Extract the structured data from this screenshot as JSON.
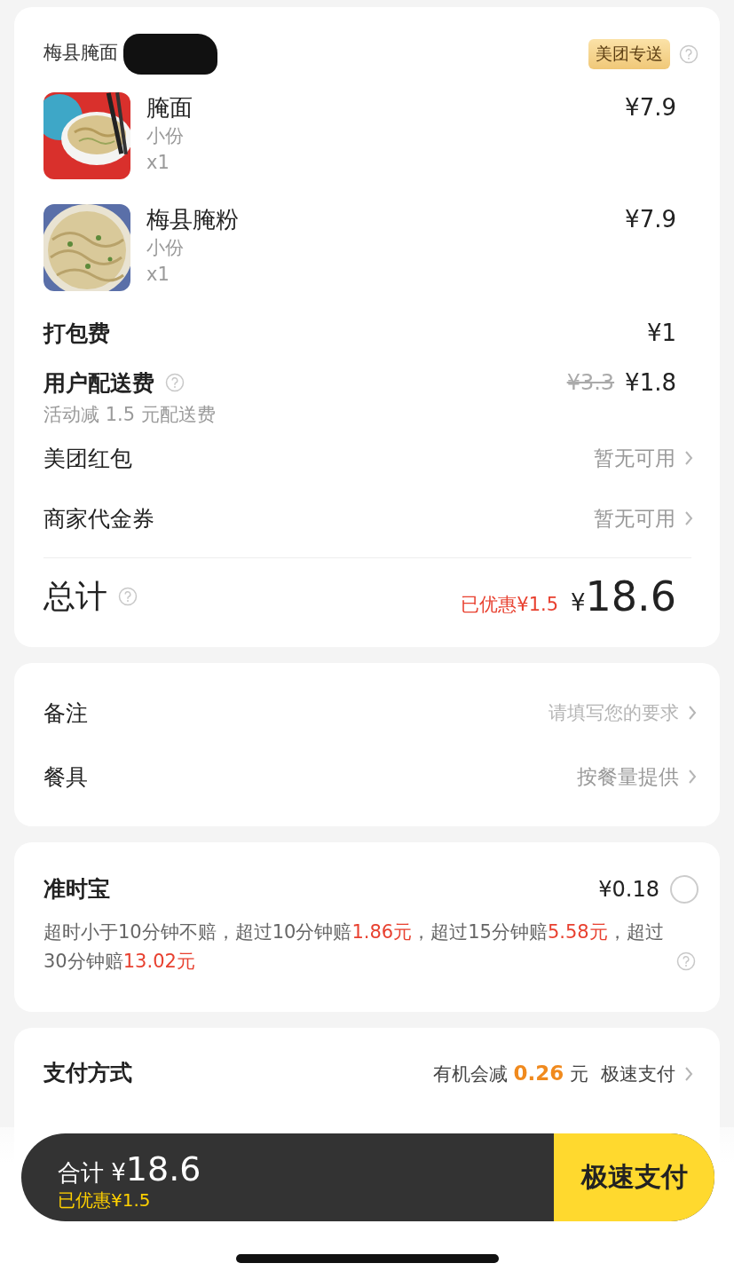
{
  "store": {
    "name": "梅县腌面",
    "badge": "美团专送"
  },
  "items": [
    {
      "name": "腌面",
      "spec": "小份",
      "qty": "x1",
      "price": "¥7.9"
    },
    {
      "name": "梅县腌粉",
      "spec": "小份",
      "qty": "x1",
      "price": "¥7.9"
    }
  ],
  "fees": [
    {
      "label": "打包费",
      "price": "¥1",
      "help": false
    },
    {
      "label": "用户配送费",
      "original": "¥3.3",
      "price": "¥1.8",
      "note": "活动减 1.5 元配送费",
      "help": true
    }
  ],
  "coupons": [
    {
      "label": "美团红包",
      "value": "暂无可用"
    },
    {
      "label": "商家代金券",
      "value": "暂无可用"
    }
  ],
  "total": {
    "label": "总计",
    "saved": "已优惠¥1.5",
    "currency": "¥",
    "amount": "18.6"
  },
  "options": [
    {
      "label": "备注",
      "placeholder": "请填写您的要求"
    },
    {
      "label": "餐具",
      "value": "按餐量提供"
    }
  ],
  "insurance": {
    "title": "准时宝",
    "price": "¥0.18",
    "selected": false,
    "terms": [
      {
        "text": "超时小于10分钟不赔，超过10分钟赔",
        "highlight": false
      },
      {
        "text": "1.86元",
        "highlight": true
      },
      {
        "text": "，超过15分钟赔",
        "highlight": false
      },
      {
        "text": "5.58元",
        "highlight": true
      },
      {
        "text": "，超过30分钟赔",
        "highlight": false
      },
      {
        "text": "13.02元",
        "highlight": true
      }
    ]
  },
  "payment": {
    "label": "支付方式",
    "hint": "有机会减 **0.26** 元",
    "method": "极速支付"
  },
  "checkout": {
    "label": "合计",
    "currency": "¥",
    "amount": "18.6",
    "saved": "已优惠¥1.5",
    "button": "极速支付"
  }
}
